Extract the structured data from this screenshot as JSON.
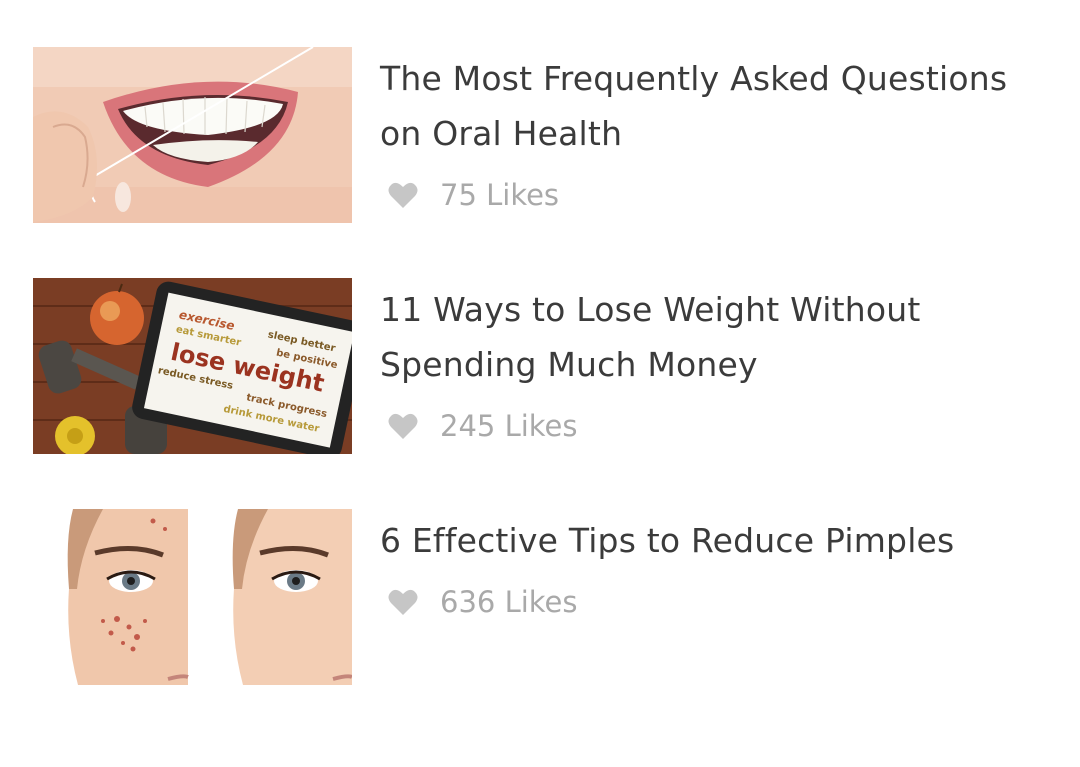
{
  "articles": [
    {
      "title": "The Most Frequently Asked Questions on Oral Health",
      "likes": "75 Likes",
      "thumbnail": "smile-flossing-photo"
    },
    {
      "title": "11 Ways to Lose Weight Without Spending Much Money",
      "likes": "245 Likes",
      "thumbnail": "weight-loss-tablet-photo",
      "thumbnail_words": {
        "w1": "exercise",
        "w2": "sleep better",
        "w3": "eat smarter",
        "w4": "be positive",
        "w5": "lose weight",
        "w6": "reduce stress",
        "w7": "track progress",
        "w8": "drink more water"
      }
    },
    {
      "title": "6 Effective Tips to Reduce Pimples",
      "likes": "636 Likes",
      "thumbnail": "acne-before-after-photo"
    }
  ],
  "icons": {
    "like": "heart-icon"
  },
  "colors": {
    "title": "#3b3b3b",
    "likes_text": "#a9a9a9",
    "heart": "#c6c6c6"
  }
}
